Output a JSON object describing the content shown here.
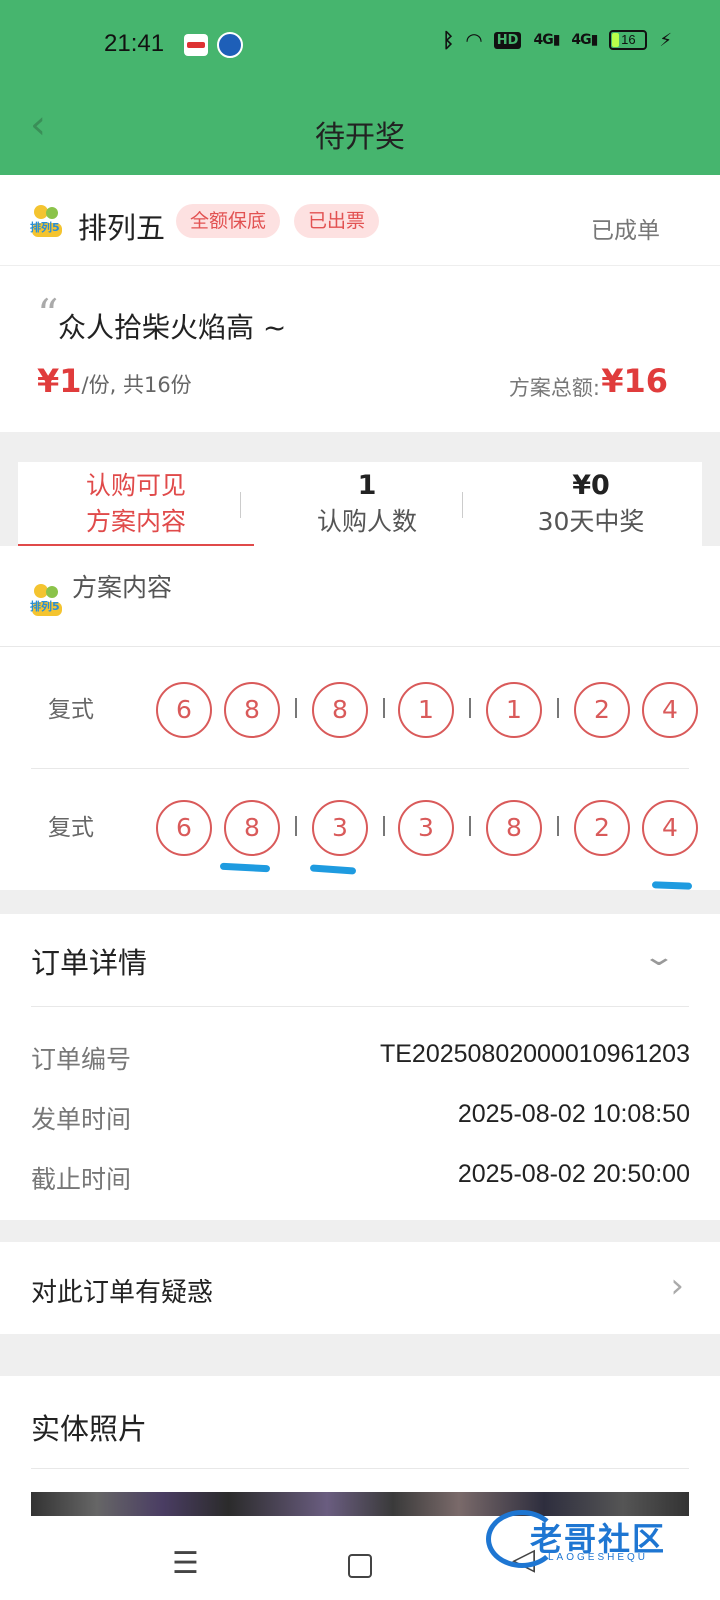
{
  "status_bar": {
    "time": "21:41",
    "hd_label": "HD",
    "signal1": "4G",
    "signal2": "4G",
    "battery": "16"
  },
  "nav": {
    "title": "待开奖",
    "back_icon": "chevron-left-icon"
  },
  "header": {
    "icon_text": "排列5",
    "lottery_name": "排列五",
    "tags": [
      "全额保底",
      "已出票"
    ],
    "order_status": "已成单"
  },
  "plan": {
    "slogan": "众人拾柴火焰高 ~",
    "unit_price": "¥1",
    "share_info": "/份, 共16份",
    "total_label": "方案总额:",
    "total_value": "¥16"
  },
  "stats_tabs": [
    {
      "line1": "认购可见",
      "line2": "方案内容"
    },
    {
      "line1": "1",
      "line2": "认购人数"
    },
    {
      "line1": "¥0",
      "line2": "30天中奖"
    }
  ],
  "content": {
    "section_title": "方案内容",
    "rows": [
      {
        "label": "复式",
        "numbers": [
          "6",
          "8",
          "8",
          "1",
          "1",
          "2",
          "4"
        ]
      },
      {
        "label": "复式",
        "numbers": [
          "6",
          "8",
          "3",
          "3",
          "8",
          "2",
          "4"
        ]
      }
    ]
  },
  "order_detail": {
    "title": "订单详情",
    "fields": [
      {
        "label": "订单编号",
        "value": "TE20250802000010961203"
      },
      {
        "label": "发单时间",
        "value": "2025-08-02 10:08:50"
      },
      {
        "label": "截止时间",
        "value": "2025-08-02 20:50:00"
      }
    ]
  },
  "question": {
    "text": "对此订单有疑惑"
  },
  "photos": {
    "title": "实体照片"
  },
  "watermark": {
    "text": "老哥社区",
    "sub": "LAOGESHEQU"
  },
  "colors": {
    "brand_green": "#46b56e",
    "accent_red": "#e03c3c",
    "annotation_blue": "#1e9be0"
  }
}
